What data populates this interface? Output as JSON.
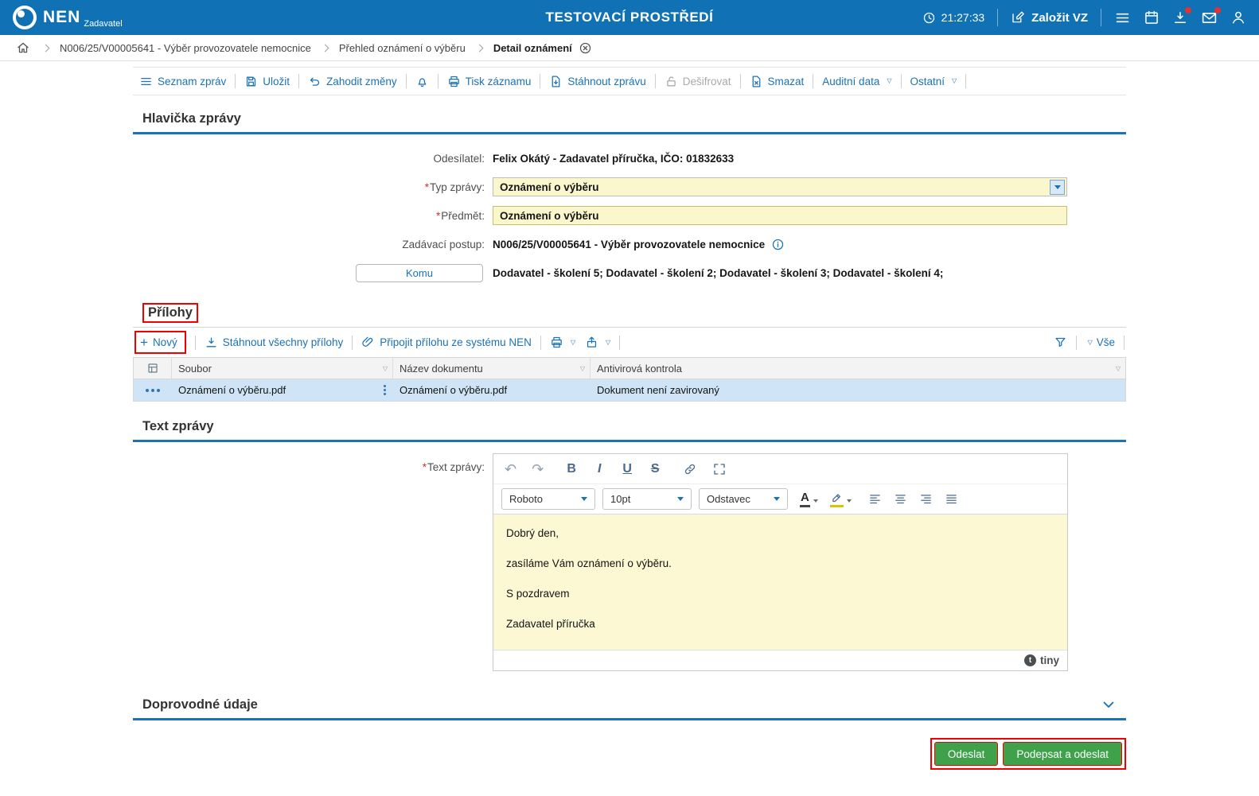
{
  "header": {
    "brand": "NEN",
    "brand_sub": "Zadavatel",
    "title": "TESTOVACÍ PROSTŘEDÍ",
    "time": "21:27:33",
    "zalozit_vz": "Založit VZ"
  },
  "breadcrumb": {
    "items": [
      "N006/25/V00005641 - Výběr provozovatele nemocnice",
      "Přehled oznámení o výběru",
      "Detail oznámení"
    ]
  },
  "toolbar": {
    "seznam": "Seznam zpráv",
    "ulozit": "Uložit",
    "zahodit": "Zahodit změny",
    "tisk": "Tisk záznamu",
    "stahnout": "Stáhnout zprávu",
    "desifrovat": "Dešifrovat",
    "smazat": "Smazat",
    "auditni": "Auditní data",
    "ostatni": "Ostatní"
  },
  "hlavicka": {
    "title": "Hlavička zprávy",
    "odesilatel_label": "Odesílatel:",
    "odesilatel": "Felix Okátý - Zadavatel příručka, IČO: 01832633",
    "typ_label": "Typ zprávy:",
    "typ": "Oznámení o výběru",
    "predmet_label": "Předmět:",
    "predmet": "Oznámení o výběru",
    "postup_label": "Zadávací postup:",
    "postup": "N006/25/V00005641 - Výběr provozovatele nemocnice",
    "komu_label": "Komu",
    "komu_value": "Dodavatel - školení 5; Dodavatel - školení 2; Dodavatel - školení 3; Dodavatel - školení 4;"
  },
  "prilohy": {
    "title": "Přílohy",
    "novy": "Nový",
    "stahnout_vse": "Stáhnout všechny přílohy",
    "pripojit": "Připojit přílohu ze systému NEN",
    "vse": "Vše",
    "columns": [
      "Soubor",
      "Název dokumentu",
      "Antivirová kontrola"
    ],
    "rows": [
      {
        "soubor": "Oznámení o výběru.pdf",
        "nazev": "Oznámení o výběru.pdf",
        "antivir": "Dokument není zavirovaný"
      }
    ]
  },
  "text_zpravy": {
    "title": "Text zprávy",
    "label": "Text zprávy:",
    "font_name": "Roboto",
    "font_size": "10pt",
    "block_type": "Odstavec",
    "lines": [
      "Dobrý den,",
      "zasíláme Vám oznámení o výběru.",
      "S pozdravem",
      "Zadavatel příručka"
    ],
    "tiny_logo": "tiny"
  },
  "doprovodne": {
    "title": "Doprovodné údaje"
  },
  "footer": {
    "odeslat": "Odeslat",
    "podepsat": "Podepsat a odeslat"
  },
  "ui": {
    "required_mark": "*"
  },
  "icons": {
    "tri_open": "▽",
    "undo": "↶",
    "redo": "↷",
    "bold": "B",
    "italic": "I",
    "underline": "U",
    "strike": "S",
    "color_letter": "A",
    "plus": "+"
  },
  "colors": {
    "header_blue": "#1171B5",
    "accent_blue": "#1B72B8",
    "field_yellow": "#FBF7CD",
    "selected_row": "#CFE5F7",
    "button_green": "#3FA24B",
    "annotation_red": "#F20000",
    "required_red": "#D32F2F"
  }
}
